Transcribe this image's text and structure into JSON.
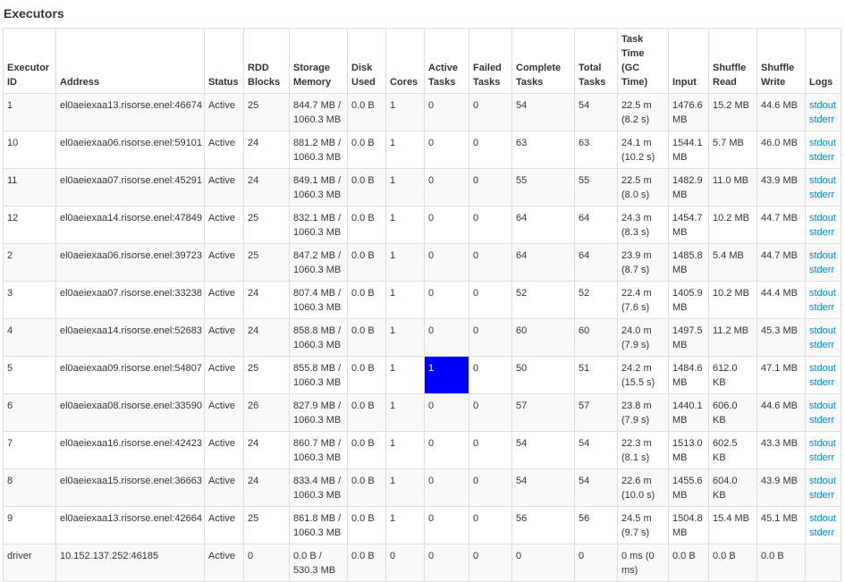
{
  "page_title": "Executors",
  "headers": [
    "Executor ID",
    "Address",
    "Status",
    "RDD Blocks",
    "Storage Memory",
    "Disk Used",
    "Cores",
    "Active Tasks",
    "Failed Tasks",
    "Complete Tasks",
    "Total Tasks",
    "Task Time (GC Time)",
    "Input",
    "Shuffle Read",
    "Shuffle Write",
    "Logs"
  ],
  "highlight_color": "#0000ff",
  "link_color": "#0088cc",
  "rows": [
    {
      "id": "1",
      "address": "el0aeiexaa13.risorse.enel:46674",
      "status": "Active",
      "rdd": "25",
      "storage": "844.7 MB / 1060.3 MB",
      "disk": "0.0 B",
      "cores": "1",
      "active": "0",
      "failed": "0",
      "complete": "54",
      "total": "54",
      "task_time": "22.5 m (8.2 s)",
      "input": "1476.6 MB",
      "shuffle_read": "15.2 MB",
      "shuffle_write": "44.6 MB",
      "logs": [
        "stdout",
        "stderr"
      ],
      "active_highlight": false
    },
    {
      "id": "10",
      "address": "el0aeiexaa06.risorse.enel:59101",
      "status": "Active",
      "rdd": "24",
      "storage": "881.2 MB / 1060.3 MB",
      "disk": "0.0 B",
      "cores": "1",
      "active": "0",
      "failed": "0",
      "complete": "63",
      "total": "63",
      "task_time": "24.1 m (10.2 s)",
      "input": "1544.1 MB",
      "shuffle_read": "5.7 MB",
      "shuffle_write": "46.0 MB",
      "logs": [
        "stdout",
        "stderr"
      ],
      "active_highlight": false
    },
    {
      "id": "11",
      "address": "el0aeiexaa07.risorse.enel:45291",
      "status": "Active",
      "rdd": "24",
      "storage": "849.1 MB / 1060.3 MB",
      "disk": "0.0 B",
      "cores": "1",
      "active": "0",
      "failed": "0",
      "complete": "55",
      "total": "55",
      "task_time": "22.5 m (8.0 s)",
      "input": "1482.9 MB",
      "shuffle_read": "11.0 MB",
      "shuffle_write": "43.9 MB",
      "logs": [
        "stdout",
        "stderr"
      ],
      "active_highlight": false
    },
    {
      "id": "12",
      "address": "el0aeiexaa14.risorse.enel:47849",
      "status": "Active",
      "rdd": "25",
      "storage": "832.1 MB / 1060.3 MB",
      "disk": "0.0 B",
      "cores": "1",
      "active": "0",
      "failed": "0",
      "complete": "64",
      "total": "64",
      "task_time": "24.3 m (8.3 s)",
      "input": "1454.7 MB",
      "shuffle_read": "10.2 MB",
      "shuffle_write": "44.7 MB",
      "logs": [
        "stdout",
        "stderr"
      ],
      "active_highlight": false
    },
    {
      "id": "2",
      "address": "el0aeiexaa06.risorse.enel:39723",
      "status": "Active",
      "rdd": "25",
      "storage": "847.2 MB / 1060.3 MB",
      "disk": "0.0 B",
      "cores": "1",
      "active": "0",
      "failed": "0",
      "complete": "64",
      "total": "64",
      "task_time": "23.9 m (8.7 s)",
      "input": "1485.8 MB",
      "shuffle_read": "5.4 MB",
      "shuffle_write": "44.7 MB",
      "logs": [
        "stdout",
        "stderr"
      ],
      "active_highlight": false
    },
    {
      "id": "3",
      "address": "el0aeiexaa07.risorse.enel:33238",
      "status": "Active",
      "rdd": "24",
      "storage": "807.4 MB / 1060.3 MB",
      "disk": "0.0 B",
      "cores": "1",
      "active": "0",
      "failed": "0",
      "complete": "52",
      "total": "52",
      "task_time": "22.4 m (7.6 s)",
      "input": "1405.9 MB",
      "shuffle_read": "10.2 MB",
      "shuffle_write": "44.4 MB",
      "logs": [
        "stdout",
        "stderr"
      ],
      "active_highlight": false
    },
    {
      "id": "4",
      "address": "el0aeiexaa14.risorse.enel:52683",
      "status": "Active",
      "rdd": "24",
      "storage": "858.8 MB / 1060.3 MB",
      "disk": "0.0 B",
      "cores": "1",
      "active": "0",
      "failed": "0",
      "complete": "60",
      "total": "60",
      "task_time": "24.0 m (7.9 s)",
      "input": "1497.5 MB",
      "shuffle_read": "11.2 MB",
      "shuffle_write": "45.3 MB",
      "logs": [
        "stdout",
        "stderr"
      ],
      "active_highlight": false
    },
    {
      "id": "5",
      "address": "el0aeiexaa09.risorse.enel:54807",
      "status": "Active",
      "rdd": "25",
      "storage": "855.8 MB / 1060.3 MB",
      "disk": "0.0 B",
      "cores": "1",
      "active": "1",
      "failed": "0",
      "complete": "50",
      "total": "51",
      "task_time": "24.2 m (15.5 s)",
      "input": "1484.6 MB",
      "shuffle_read": "612.0 KB",
      "shuffle_write": "47.1 MB",
      "logs": [
        "stdout",
        "stderr"
      ],
      "active_highlight": true
    },
    {
      "id": "6",
      "address": "el0aeiexaa08.risorse.enel:33590",
      "status": "Active",
      "rdd": "26",
      "storage": "827.9 MB / 1060.3 MB",
      "disk": "0.0 B",
      "cores": "1",
      "active": "0",
      "failed": "0",
      "complete": "57",
      "total": "57",
      "task_time": "23.8 m (7.9 s)",
      "input": "1440.1 MB",
      "shuffle_read": "606.0 KB",
      "shuffle_write": "44.6 MB",
      "logs": [
        "stdout",
        "stderr"
      ],
      "active_highlight": false
    },
    {
      "id": "7",
      "address": "el0aeiexaa16.risorse.enel:42423",
      "status": "Active",
      "rdd": "24",
      "storage": "860.7 MB / 1060.3 MB",
      "disk": "0.0 B",
      "cores": "1",
      "active": "0",
      "failed": "0",
      "complete": "54",
      "total": "54",
      "task_time": "22.3 m (8.1 s)",
      "input": "1513.0 MB",
      "shuffle_read": "602.5 KB",
      "shuffle_write": "43.3 MB",
      "logs": [
        "stdout",
        "stderr"
      ],
      "active_highlight": false
    },
    {
      "id": "8",
      "address": "el0aeiexaa15.risorse.enel:36663",
      "status": "Active",
      "rdd": "24",
      "storage": "833.4 MB / 1060.3 MB",
      "disk": "0.0 B",
      "cores": "1",
      "active": "0",
      "failed": "0",
      "complete": "54",
      "total": "54",
      "task_time": "22.6 m (10.0 s)",
      "input": "1455.6 MB",
      "shuffle_read": "604.0 KB",
      "shuffle_write": "43.9 MB",
      "logs": [
        "stdout",
        "stderr"
      ],
      "active_highlight": false
    },
    {
      "id": "9",
      "address": "el0aeiexaa13.risorse.enel:42664",
      "status": "Active",
      "rdd": "25",
      "storage": "861.8 MB / 1060.3 MB",
      "disk": "0.0 B",
      "cores": "1",
      "active": "0",
      "failed": "0",
      "complete": "56",
      "total": "56",
      "task_time": "24.5 m (9.7 s)",
      "input": "1504.8 MB",
      "shuffle_read": "15.4 MB",
      "shuffle_write": "45.1 MB",
      "logs": [
        "stdout",
        "stderr"
      ],
      "active_highlight": false
    },
    {
      "id": "driver",
      "address": "10.152.137.252:46185",
      "status": "Active",
      "rdd": "0",
      "storage": "0.0 B / 530.3 MB",
      "disk": "0.0 B",
      "cores": "0",
      "active": "0",
      "failed": "0",
      "complete": "0",
      "total": "0",
      "task_time": "0 ms (0 ms)",
      "input": "0.0 B",
      "shuffle_read": "0.0 B",
      "shuffle_write": "0.0 B",
      "logs": [],
      "active_highlight": false
    }
  ]
}
